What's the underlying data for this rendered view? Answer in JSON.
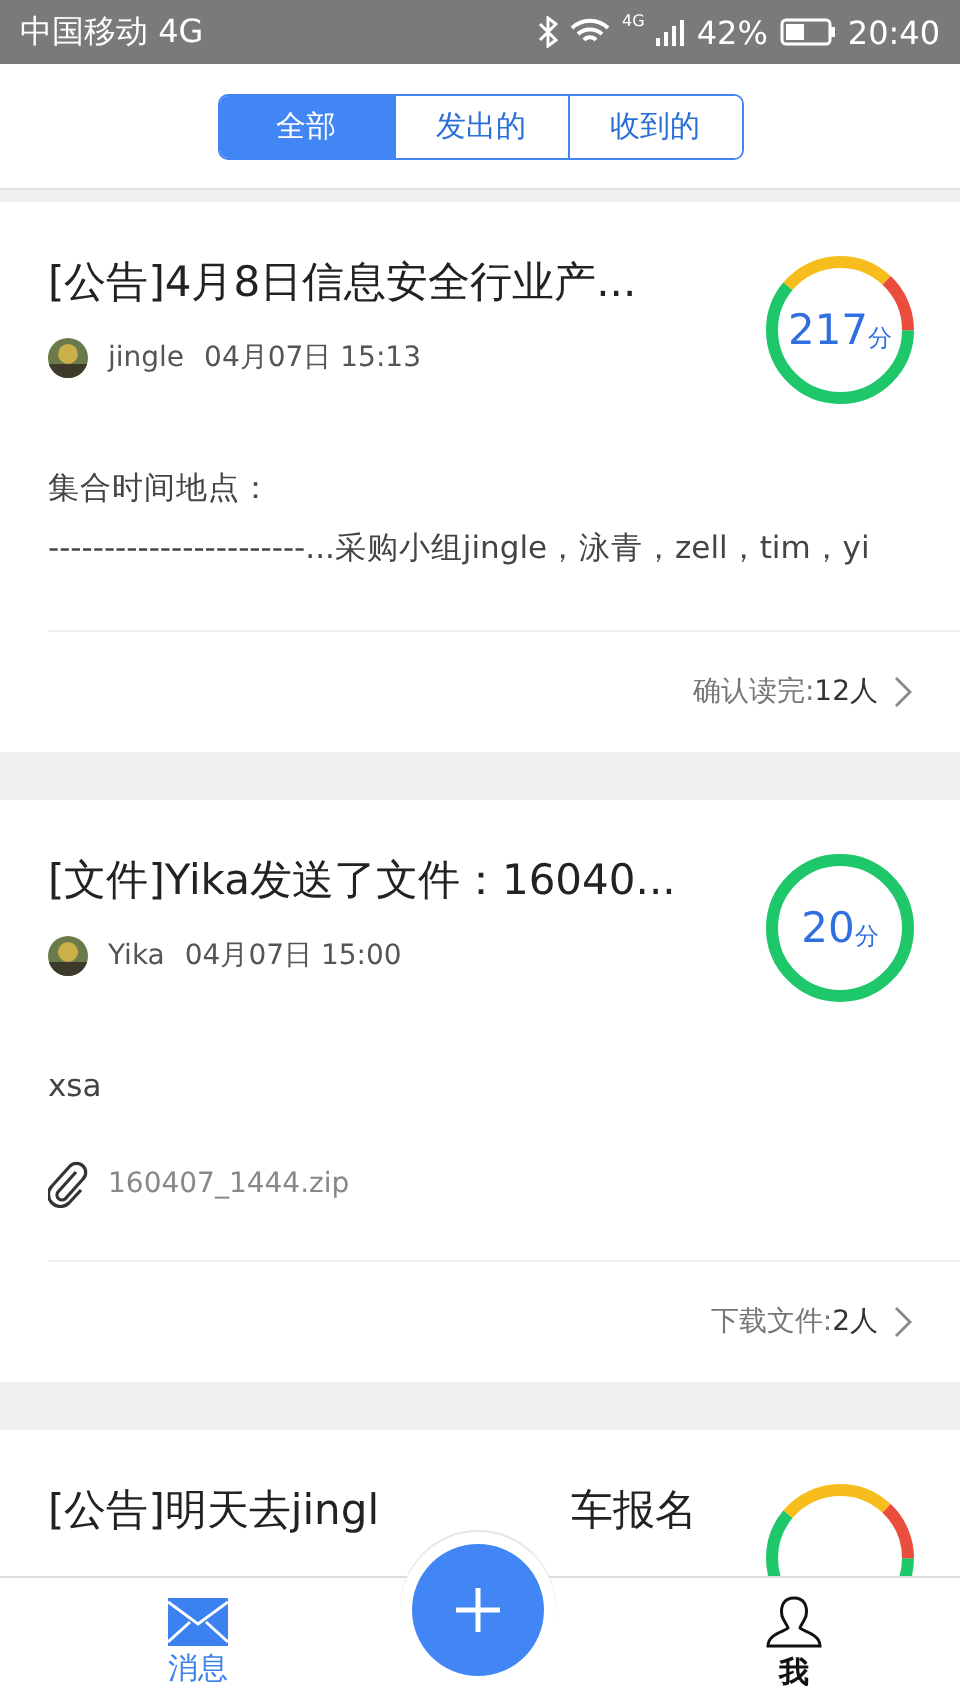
{
  "status_bar": {
    "carrier": "中国移动 4G",
    "network": "4G",
    "battery": "42%",
    "time": "20:40"
  },
  "tabs": [
    {
      "label": "全部",
      "selected": true
    },
    {
      "label": "发出的",
      "selected": false
    },
    {
      "label": "收到的",
      "selected": false
    }
  ],
  "cards": [
    {
      "title": "[公告]4月8日信息安全行业产...",
      "author": "jingle",
      "time": "04月07日 15:13",
      "score": "217",
      "unit": "分",
      "kind": "mixed",
      "body": [
        "集合时间地点：",
        "-----------------------...采购小组jingle，泳青，zell，tim，yi"
      ],
      "footer_label": "确认读完:",
      "footer_value": "12人"
    },
    {
      "title": "[文件]Yika发送了文件：16040...",
      "author": "Yika",
      "time": "04月07日 15:00",
      "score": "20",
      "unit": "分",
      "kind": "green",
      "body": [
        "xsa"
      ],
      "attachment": "160407_1444.zip",
      "footer_label": "下载文件:",
      "footer_value": "2人"
    }
  ],
  "partial_card": {
    "title_parts": [
      "[公告]明天去jingl",
      "车报名"
    ]
  },
  "bottom_nav": [
    {
      "label": "消息",
      "kind": "mail",
      "selected": true
    },
    {
      "label": "我",
      "kind": "person",
      "selected": false
    }
  ]
}
